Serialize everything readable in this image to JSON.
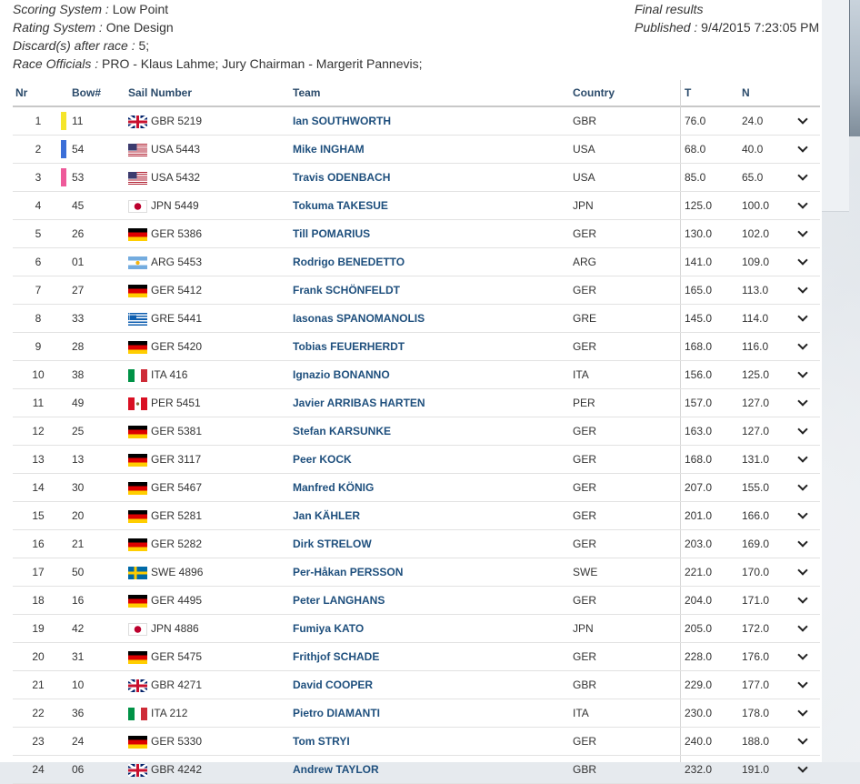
{
  "meta": {
    "scoring_label": "Scoring System :",
    "scoring_value": "Low Point",
    "rating_label": "Rating System :",
    "rating_value": "One Design",
    "discard_label": "Discard(s) after race :",
    "discard_value": "5;",
    "officials_label": "Race Officials :",
    "officials_value": "PRO - Klaus Lahme; Jury Chairman - Margerit Pannevis;",
    "final_results": "Final results",
    "published_label": "Published :",
    "published_value": "9/4/2015 7:23:05 PM"
  },
  "table": {
    "headers": {
      "nr": "Nr",
      "bow": "Bow#",
      "sail": "Sail Number",
      "team": "Team",
      "country": "Country",
      "t": "T",
      "n": "N"
    },
    "rows": [
      {
        "nr": "1",
        "bow": "11",
        "sail": "GBR 5219",
        "team": "Ian SOUTHWORTH",
        "country": "GBR",
        "t": "76.0",
        "n": "24.0",
        "flag": "gbr",
        "medal": "#f5e52a"
      },
      {
        "nr": "2",
        "bow": "54",
        "sail": "USA 5443",
        "team": "Mike INGHAM",
        "country": "USA",
        "t": "68.0",
        "n": "40.0",
        "flag": "usa",
        "medal": "#3b6fd8"
      },
      {
        "nr": "3",
        "bow": "53",
        "sail": "USA 5432",
        "team": "Travis ODENBACH",
        "country": "USA",
        "t": "85.0",
        "n": "65.0",
        "flag": "usa",
        "medal": "#ee5a9a"
      },
      {
        "nr": "4",
        "bow": "45",
        "sail": "JPN 5449",
        "team": "Tokuma TAKESUE",
        "country": "JPN",
        "t": "125.0",
        "n": "100.0",
        "flag": "jpn",
        "medal": ""
      },
      {
        "nr": "5",
        "bow": "26",
        "sail": "GER 5386",
        "team": "Till POMARIUS",
        "country": "GER",
        "t": "130.0",
        "n": "102.0",
        "flag": "ger",
        "medal": ""
      },
      {
        "nr": "6",
        "bow": "01",
        "sail": "ARG 5453",
        "team": "Rodrigo BENEDETTO",
        "country": "ARG",
        "t": "141.0",
        "n": "109.0",
        "flag": "arg",
        "medal": ""
      },
      {
        "nr": "7",
        "bow": "27",
        "sail": "GER 5412",
        "team": "Frank SCHÖNFELDT",
        "country": "GER",
        "t": "165.0",
        "n": "113.0",
        "flag": "ger",
        "medal": ""
      },
      {
        "nr": "8",
        "bow": "33",
        "sail": "GRE 5441",
        "team": "Iasonas SPANOMANOLIS",
        "country": "GRE",
        "t": "145.0",
        "n": "114.0",
        "flag": "gre",
        "medal": ""
      },
      {
        "nr": "9",
        "bow": "28",
        "sail": "GER 5420",
        "team": "Tobias FEUERHERDT",
        "country": "GER",
        "t": "168.0",
        "n": "116.0",
        "flag": "ger",
        "medal": ""
      },
      {
        "nr": "10",
        "bow": "38",
        "sail": "ITA 416",
        "team": "Ignazio BONANNO",
        "country": "ITA",
        "t": "156.0",
        "n": "125.0",
        "flag": "ita",
        "medal": ""
      },
      {
        "nr": "11",
        "bow": "49",
        "sail": "PER 5451",
        "team": "Javier ARRIBAS HARTEN",
        "country": "PER",
        "t": "157.0",
        "n": "127.0",
        "flag": "per",
        "medal": ""
      },
      {
        "nr": "12",
        "bow": "25",
        "sail": "GER 5381",
        "team": "Stefan KARSUNKE",
        "country": "GER",
        "t": "163.0",
        "n": "127.0",
        "flag": "ger",
        "medal": ""
      },
      {
        "nr": "13",
        "bow": "13",
        "sail": "GER 3117",
        "team": "Peer KOCK",
        "country": "GER",
        "t": "168.0",
        "n": "131.0",
        "flag": "ger",
        "medal": ""
      },
      {
        "nr": "14",
        "bow": "30",
        "sail": "GER 5467",
        "team": "Manfred KÖNIG",
        "country": "GER",
        "t": "207.0",
        "n": "155.0",
        "flag": "ger",
        "medal": ""
      },
      {
        "nr": "15",
        "bow": "20",
        "sail": "GER 5281",
        "team": "Jan KÄHLER",
        "country": "GER",
        "t": "201.0",
        "n": "166.0",
        "flag": "ger",
        "medal": ""
      },
      {
        "nr": "16",
        "bow": "21",
        "sail": "GER 5282",
        "team": "Dirk STRELOW",
        "country": "GER",
        "t": "203.0",
        "n": "169.0",
        "flag": "ger",
        "medal": ""
      },
      {
        "nr": "17",
        "bow": "50",
        "sail": "SWE 4896",
        "team": "Per-Håkan PERSSON",
        "country": "SWE",
        "t": "221.0",
        "n": "170.0",
        "flag": "swe",
        "medal": ""
      },
      {
        "nr": "18",
        "bow": "16",
        "sail": "GER 4495",
        "team": "Peter LANGHANS",
        "country": "GER",
        "t": "204.0",
        "n": "171.0",
        "flag": "ger",
        "medal": ""
      },
      {
        "nr": "19",
        "bow": "42",
        "sail": "JPN 4886",
        "team": "Fumiya KATO",
        "country": "JPN",
        "t": "205.0",
        "n": "172.0",
        "flag": "jpn",
        "medal": ""
      },
      {
        "nr": "20",
        "bow": "31",
        "sail": "GER 5475",
        "team": "Frithjof SCHADE",
        "country": "GER",
        "t": "228.0",
        "n": "176.0",
        "flag": "ger",
        "medal": ""
      },
      {
        "nr": "21",
        "bow": "10",
        "sail": "GBR 4271",
        "team": "David COOPER",
        "country": "GBR",
        "t": "229.0",
        "n": "177.0",
        "flag": "gbr",
        "medal": ""
      },
      {
        "nr": "22",
        "bow": "36",
        "sail": "ITA 212",
        "team": "Pietro DIAMANTI",
        "country": "ITA",
        "t": "230.0",
        "n": "178.0",
        "flag": "ita",
        "medal": ""
      },
      {
        "nr": "23",
        "bow": "24",
        "sail": "GER 5330",
        "team": "Tom STRYI",
        "country": "GER",
        "t": "240.0",
        "n": "188.0",
        "flag": "ger",
        "medal": ""
      },
      {
        "nr": "24",
        "bow": "06",
        "sail": "GBR 4242",
        "team": "Andrew TAYLOR",
        "country": "GBR",
        "t": "232.0",
        "n": "191.0",
        "flag": "gbr",
        "medal": ""
      }
    ]
  }
}
